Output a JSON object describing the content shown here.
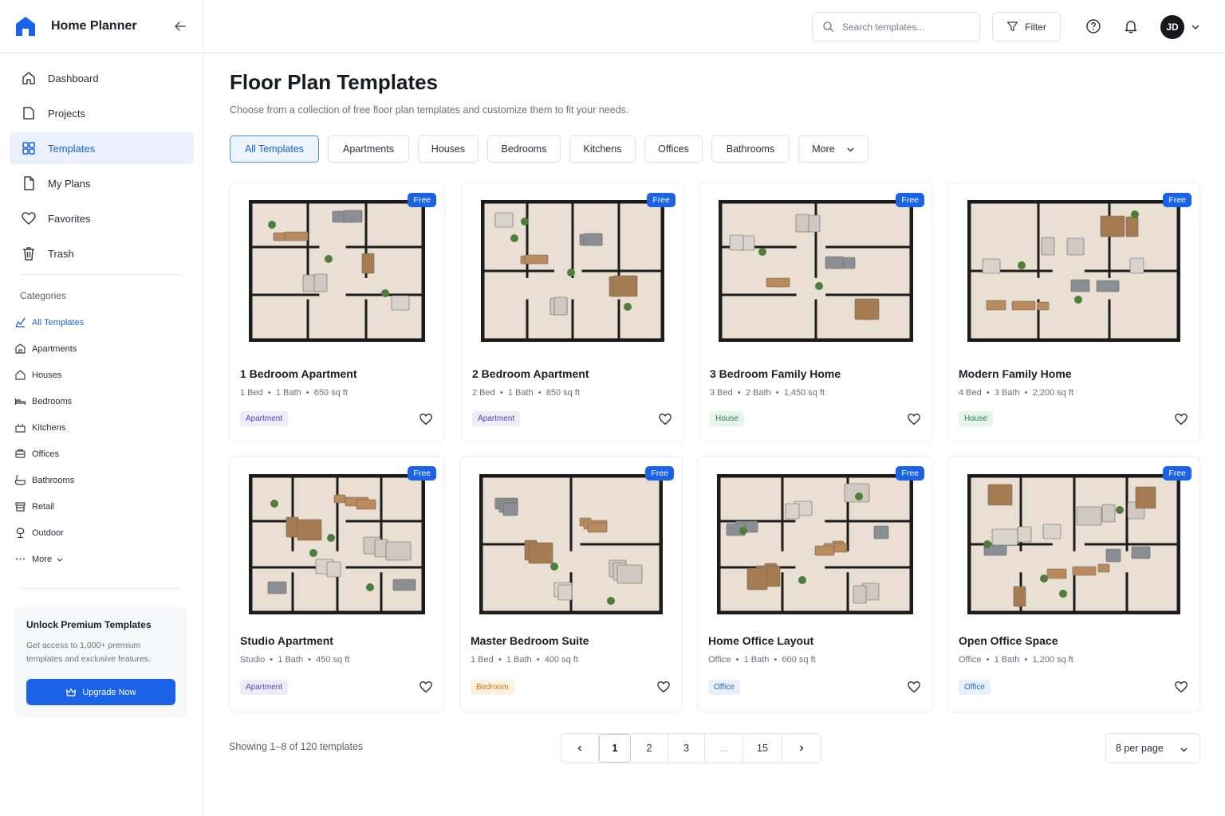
{
  "app": {
    "title": "Home Planner"
  },
  "sidebar": {
    "nav": [
      {
        "label": "Dashboard",
        "icon": "home-icon",
        "active": false
      },
      {
        "label": "Projects",
        "icon": "folder-icon",
        "active": false
      },
      {
        "label": "Templates",
        "icon": "templates-grid-icon",
        "active": true
      },
      {
        "label": "My Plans",
        "icon": "document-icon",
        "active": false
      },
      {
        "label": "Favorites",
        "icon": "heart-icon",
        "active": false
      },
      {
        "label": "Trash",
        "icon": "trash-icon",
        "active": false
      }
    ],
    "categories_title": "Categories",
    "categories": [
      {
        "label": "All Templates",
        "icon": "all-templates-icon",
        "active": true
      },
      {
        "label": "Apartments",
        "icon": "building-icon",
        "active": false
      },
      {
        "label": "Houses",
        "icon": "house-icon",
        "active": false
      },
      {
        "label": "Bedrooms",
        "icon": "bed-icon",
        "active": false
      },
      {
        "label": "Kitchens",
        "icon": "kitchen-icon",
        "active": false
      },
      {
        "label": "Offices",
        "icon": "office-icon",
        "active": false
      },
      {
        "label": "Bathrooms",
        "icon": "bathtub-icon",
        "active": false
      },
      {
        "label": "Retail",
        "icon": "store-icon",
        "active": false
      },
      {
        "label": "Outdoor",
        "icon": "tree-icon",
        "active": false
      },
      {
        "label": "More",
        "icon": "more-dots-icon",
        "active": false
      }
    ],
    "premium": {
      "title": "Unlock Premium Templates",
      "text": "Get access to 1,000+ premium templates and exclusive features.",
      "button": "Upgrade Now"
    }
  },
  "header": {
    "search_placeholder": "Search templates...",
    "filter_label": "Filter",
    "avatar_initials": "JD"
  },
  "main": {
    "title": "Floor Plan Templates",
    "subtitle": "Choose from a collection of free floor plan templates and customize them to fit your needs.",
    "chips": [
      "All Templates",
      "Apartments",
      "Houses",
      "Bedrooms",
      "Kitchens",
      "Offices",
      "Bathrooms",
      "More"
    ],
    "active_chip": "All Templates",
    "cards": [
      {
        "title": "1 Bedroom Apartment",
        "meta": "1 Bed  •  1 Bath  •  650 sq ft",
        "tag": "Apartment",
        "tag_type": "apartment",
        "badge": "Free"
      },
      {
        "title": "2 Bedroom Apartment",
        "meta": "2 Bed  •  1 Bath  •  850 sq ft",
        "tag": "Apartment",
        "tag_type": "apartment",
        "badge": "Free"
      },
      {
        "title": "3 Bedroom Family Home",
        "meta": "3 Bed  •  2 Bath  •  1,450 sq ft",
        "tag": "House",
        "tag_type": "house",
        "badge": "Free"
      },
      {
        "title": "Modern Family Home",
        "meta": "4 Bed  •  3 Bath  •  2,200 sq ft",
        "tag": "House",
        "tag_type": "house",
        "badge": "Free"
      },
      {
        "title": "Studio Apartment",
        "meta": "Studio  •  1 Bath  •  450 sq ft",
        "tag": "Apartment",
        "tag_type": "apartment",
        "badge": "Free"
      },
      {
        "title": "Master Bedroom Suite",
        "meta": "1 Bed  •  1 Bath  •  400 sq ft",
        "tag": "Bedroom",
        "tag_type": "bedroom",
        "badge": "Free"
      },
      {
        "title": "Home Office Layout",
        "meta": "Office  •  1 Bath  •  600 sq ft",
        "tag": "Office",
        "tag_type": "office",
        "badge": "Free"
      },
      {
        "title": "Open Office Space",
        "meta": "Office  •  1 Bath  •  1,200 sq ft",
        "tag": "Office",
        "tag_type": "office",
        "badge": "Free"
      }
    ],
    "showing": "Showing 1–8 of 120 templates",
    "pages": [
      "1",
      "2",
      "3",
      "...",
      "15"
    ],
    "current_page": "1",
    "per_page": "8 per page"
  },
  "colors": {
    "accent": "#1a62e6",
    "active_bg": "#eaf1fd"
  }
}
